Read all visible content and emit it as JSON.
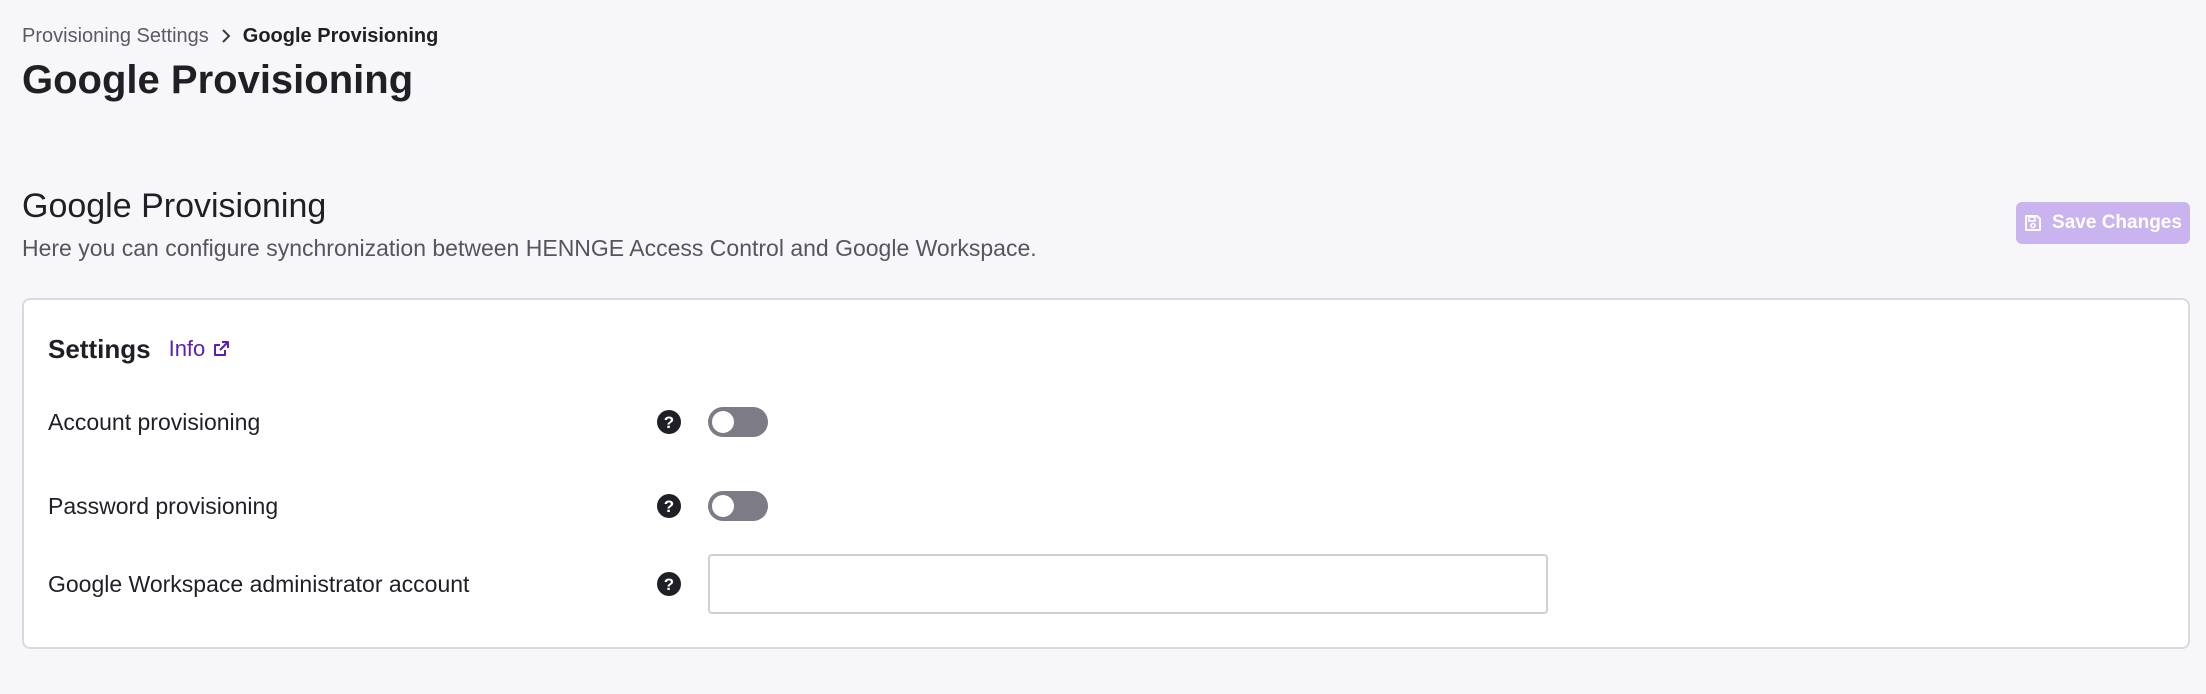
{
  "breadcrumb": {
    "parent": "Provisioning Settings",
    "current": "Google Provisioning"
  },
  "page": {
    "title": "Google Provisioning"
  },
  "section": {
    "title": "Google Provisioning",
    "description": "Here you can configure synchronization between HENNGE Access Control and Google Workspace.",
    "save_label": "Save Changes",
    "save_enabled": false
  },
  "settings": {
    "title": "Settings",
    "info_label": "Info",
    "rows": [
      {
        "label": "Account provisioning",
        "type": "toggle",
        "enabled": false
      },
      {
        "label": "Password provisioning",
        "type": "toggle",
        "enabled": false
      },
      {
        "label": "Google Workspace administrator account",
        "type": "text",
        "value": "",
        "placeholder": ""
      }
    ]
  },
  "icons": {
    "breadcrumb_separator": "chevron-right-icon",
    "save": "floppy-disk-icon",
    "info": "external-link-icon",
    "help": "question-circle-icon"
  },
  "colors": {
    "background": "#f7f7f9",
    "accent": "#5b1fb0",
    "save_disabled_bg": "#c9b4f0",
    "toggle_off": "#7d7b86",
    "text_primary": "#1f1f26",
    "text_secondary": "#55555f"
  }
}
